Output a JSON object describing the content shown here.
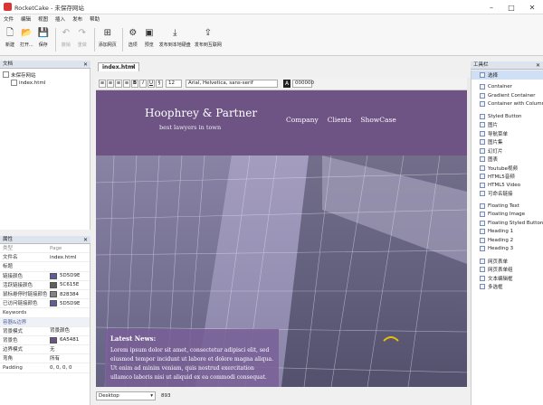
{
  "window": {
    "title": "RocketCake - 未保存网站"
  },
  "menu": [
    "文件",
    "编辑",
    "视图",
    "插入",
    "发布",
    "帮助"
  ],
  "toolbar": [
    {
      "icon": "new-icon",
      "glyph": "🗋",
      "label": "新建",
      "disabled": false
    },
    {
      "icon": "open-icon",
      "glyph": "📂",
      "label": "打开...",
      "disabled": false
    },
    {
      "icon": "save-icon",
      "glyph": "💾",
      "label": "保存",
      "disabled": false
    },
    {
      "icon": "undo-icon",
      "glyph": "↶",
      "label": "撤销",
      "disabled": true
    },
    {
      "icon": "redo-icon",
      "glyph": "↷",
      "label": "重做",
      "disabled": true
    },
    {
      "icon": "add-page-icon",
      "glyph": "⊞",
      "label": "添加网页",
      "disabled": false
    },
    {
      "icon": "gear-icon",
      "glyph": "⚙",
      "label": "选项",
      "disabled": false
    },
    {
      "icon": "preview-icon",
      "glyph": "▣",
      "label": "预览",
      "disabled": false
    },
    {
      "icon": "publish-local-icon",
      "glyph": "⤓",
      "label": "发布到本地硬盘",
      "disabled": false
    },
    {
      "icon": "publish-web-icon",
      "glyph": "⇪",
      "label": "发布到互联网",
      "disabled": false
    }
  ],
  "files_panel": {
    "title": "文档",
    "root": "未保存网站",
    "page": "index.html"
  },
  "props_panel": {
    "title": "属性",
    "header": {
      "k": "类型",
      "v": "Page"
    },
    "rows": [
      {
        "k": "文件名",
        "v": "index.html",
        "color": ""
      },
      {
        "k": "标题",
        "v": "",
        "color": ""
      },
      {
        "k": "链接颜色",
        "v": "5D5D9E",
        "color": "#5D5D9E"
      },
      {
        "k": "活跃链接颜色",
        "v": "5C615E",
        "color": "#5C615E"
      },
      {
        "k": "鼠标悬停时链接颜色",
        "v": "828384",
        "color": "#828384"
      },
      {
        "k": "已访问链接颜色",
        "v": "5D5D9E",
        "color": "#5D5D9E"
      },
      {
        "k": "Keywords",
        "v": "",
        "color": ""
      }
    ],
    "section": "容器&边界",
    "rows2": [
      {
        "k": "背景模式",
        "v": "背景颜色",
        "color": ""
      },
      {
        "k": "背景色",
        "v": "6A5481",
        "color": "#6A5481"
      },
      {
        "k": "边界模式",
        "v": "无",
        "color": ""
      },
      {
        "k": "弯角",
        "v": "所有",
        "color": ""
      },
      {
        "k": "Padding",
        "v": "0, 0, 0, 0",
        "color": ""
      }
    ]
  },
  "editor": {
    "tab": "index.html",
    "font": "Arial, Helvetica, sans-serif",
    "size": "12",
    "text_color": "000000",
    "fmt_buttons": [
      "≡",
      "≡",
      "≡",
      "≡",
      "B",
      "I",
      "U",
      "§"
    ]
  },
  "site": {
    "brand": "Hoophrey & Partner",
    "tagline": "best lawyers in town",
    "nav": [
      "Company",
      "Clients",
      "ShowCase"
    ],
    "news_title": "Latest News:",
    "news_body": "Lorem ipsum dolor sit amet, consectetur adipisci elit, sed eiusmod tempor incidunt ut labore et dolore magna aliqua. Ut enim ad minim veniam, quis nostrud exercitation ullamco laboris nisi ut aliquid ex ea commodi consequat."
  },
  "status": {
    "mode": "Desktop",
    "width": "893"
  },
  "toolbox": {
    "title": "工具栏",
    "selected": "选择",
    "groups": [
      [
        "Container",
        "Gradient Container",
        "Container with Column"
      ],
      [
        "Styled Button",
        "图片",
        "导航菜单",
        "图片集",
        "幻灯片",
        "图表",
        "Youtube视频",
        "HTML5音频",
        "HTML5 Video",
        "可命名链接"
      ],
      [
        "Floating Text",
        "Floating Image",
        "Floating Styled Button",
        "Heading 1",
        "Heading 2",
        "Heading 3"
      ],
      [
        "网页表单",
        "网页表单组",
        "文本编辑框",
        "多选框"
      ]
    ]
  },
  "colors": {
    "brand": "#6d5485",
    "accent": "#5D5D9E"
  }
}
